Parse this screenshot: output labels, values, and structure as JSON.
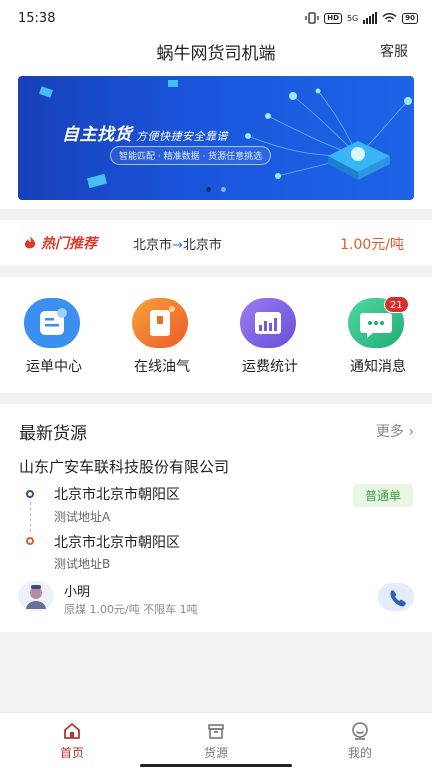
{
  "status_bar": {
    "time": "15:38",
    "network": "5G",
    "hd_label": "HD",
    "battery": "90"
  },
  "header": {
    "title": "蜗牛网货司机端",
    "right_action": "客服"
  },
  "banner": {
    "title": "自主找货",
    "title_suffix": "方便快捷安全靠谱",
    "subtitle": "智能匹配 · 精准数据 · 货源任意挑选",
    "slides": 2,
    "active_slide": 1
  },
  "hot_recommend": {
    "label": "热门推荐",
    "from": "北京市",
    "arrow": "→",
    "to": "北京市",
    "price": "1.00元/吨"
  },
  "quick_menu": [
    {
      "label": "运单中心",
      "icon": "waybill-icon",
      "color": "#3b8ff0"
    },
    {
      "label": "在线油气",
      "icon": "fuel-icon",
      "color": "#f06a32"
    },
    {
      "label": "运费统计",
      "icon": "chart-stats-icon",
      "color": "#7a5ae0"
    },
    {
      "label": "通知消息",
      "icon": "message-icon",
      "color": "#2fbf8a",
      "badge": "21"
    }
  ],
  "latest_cargo": {
    "title": "最新货源",
    "more": "更多",
    "company": "山东广安车联科技股份有限公司",
    "origin": {
      "city": "北京市北京市朝阳区",
      "detail": "测试地址A"
    },
    "destination": {
      "city": "北京市北京市朝阳区",
      "detail": "测试地址B"
    },
    "tag": "普通单",
    "driver": "小明",
    "description": "原煤 1.00元/吨 不限车 1吨"
  },
  "tabs": [
    {
      "label": "首页",
      "icon": "home-icon",
      "active": true
    },
    {
      "label": "货源",
      "icon": "cargo-box-icon",
      "active": false
    },
    {
      "label": "我的",
      "icon": "profile-icon",
      "active": false
    }
  ],
  "colors": {
    "accent_red": "#b8332c",
    "price": "#e05a2b",
    "brand_blue": "#1a56dc",
    "tag_green": "#3c9e3c"
  }
}
